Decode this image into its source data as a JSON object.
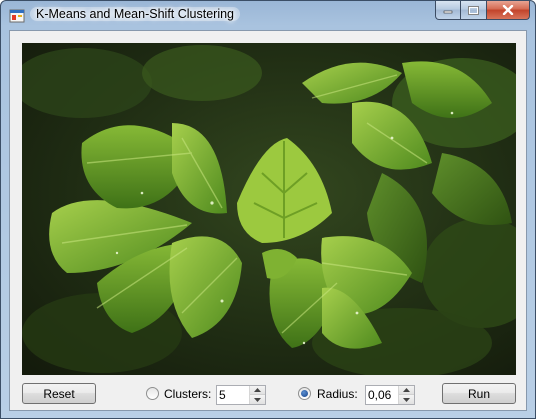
{
  "window": {
    "title": "K-Means and Mean-Shift Clustering",
    "app_icon": "windows-forms-icon",
    "caption_icons": [
      "minimize-icon",
      "maximize-icon",
      "close-icon"
    ]
  },
  "image": {
    "subject": "green-leaves-photo",
    "colors": {
      "dark_bg": "#1c2613",
      "leaf_light": "#8fbf3a",
      "leaf_mid": "#5e9424",
      "leaf_dark": "#3a6516"
    }
  },
  "controls": {
    "reset_label": "Reset",
    "clusters_label": "Clusters:",
    "clusters_value": "5",
    "clusters_selected": false,
    "radius_label": "Radius:",
    "radius_value": "0,06",
    "radius_selected": true,
    "run_label": "Run"
  }
}
